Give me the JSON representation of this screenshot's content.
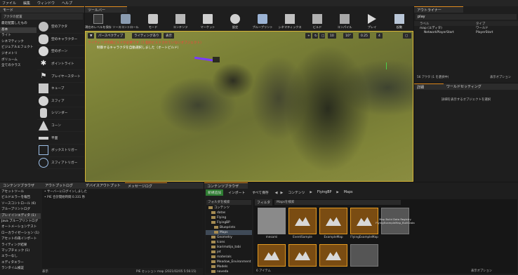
{
  "menu": [
    "ファイル",
    "編集",
    "ウィンドウ",
    "ヘルプ"
  ],
  "modes_panel": {
    "tab": "モード",
    "search_placeholder": "アクタの配置",
    "categories": [
      "最近配置したもの",
      "基本",
      "ライト",
      "シネマティック",
      "ビジュアルエフェクト",
      "ジオメトリ",
      "ボリューム",
      "全てのクラス"
    ],
    "items": [
      "空のアクタ",
      "空のキャラクター",
      "空のポーン",
      "ポイントライト",
      "プレイヤースタート",
      "キューブ",
      "スフィア",
      "シリンダー",
      "コーン",
      "平面",
      "ボックストリガー",
      "スフィアトリガー"
    ]
  },
  "toolbar": {
    "tab": "ツールバー",
    "buttons": [
      "現在のレベルを保存",
      "ソースコントロール",
      "モード",
      "コンテンツ",
      "マーケット",
      "設定",
      "ブループリント",
      "シネマティックス",
      "ビルド",
      "コンパイル",
      "プレイ",
      "起動"
    ]
  },
  "viewport": {
    "perspective": "パースペクティブ",
    "lighting": "ライティングあり",
    "show": "表示",
    "warning1": "ライティングの再ビルドが必要です（1 個のビルドされていないオブジェクト）",
    "warning2": "制御するキャラクタを自動選択しました（オートビルド）",
    "grid_values": [
      "10",
      "10°",
      "0.25",
      "4"
    ]
  },
  "outliner": {
    "tab": "アウトライナー",
    "search_value": "play",
    "col_label": "ラベル",
    "col_type": "タイプ",
    "rows": [
      {
        "label": "map (エディタ)",
        "type": "ワールド"
      },
      {
        "label": "NetworkPlayerStart",
        "type": "PlayerStart"
      }
    ],
    "footer": "56 アクタ (1 を選択中)",
    "view_options": "表示オプション"
  },
  "details": {
    "tab_details": "詳細",
    "tab_world": "ワールドセッティング",
    "empty_text": "詳細を表示するオブジェクトを選択"
  },
  "bottom_left": {
    "tabs": [
      "コンテンツブラウザ",
      "アウトプットログ",
      "デバイスアウトプット",
      "メッセージログ"
    ],
    "categories": [
      "アセットツール",
      "ビルドエラーを報告",
      "ソースコントロール (6)",
      "ブループリントログ",
      "プレイインエディタ (1)",
      "Java ブループリントログ",
      "オートメーションテスト",
      "ローカライゼーション (1)",
      "アセットの再インポート",
      "ライティング結果",
      "マップチェック (1)",
      "エラーなし",
      "エディタエラー",
      "ランタイム検証"
    ],
    "log_lines": [
      "サーバーにログインしました",
      "PIE 合計開始時間 0.331 秒"
    ],
    "footer_left": "表示",
    "footer_session": "PIE セッション map (2021/02/05 5:56:15)"
  },
  "content_browser": {
    "tab": "コンテンツブラウザ",
    "add_new": "新規追加",
    "import": "インポート",
    "save_all": "すべて保存",
    "path": [
      "コンテンツ",
      "FlyingBP",
      "Maps"
    ],
    "search_folders": "フォルダを検索",
    "search_assets": "Mapsを検索",
    "filter": "フィルタ",
    "folders": [
      "コンテンツ",
      "datas",
      "Flying",
      "FlyingBP",
      "Blueprints",
      "Maps",
      "Geometry",
      "Icons",
      "ikarimotijo_tobi",
      "jet",
      "materials",
      "Meadow_Environment",
      "Models",
      "naveda",
      "news"
    ],
    "assets": [
      "mesami",
      "EventSample",
      "ExampleMap",
      "FlyingExampleMap",
      "Map Build Data Registry FlyingExampleMap_BuiltData"
    ],
    "footer": "6 アイテム",
    "view_options": "表示オプション"
  },
  "colors": {
    "accent": "#e08a1e",
    "selection": "#3f4a57",
    "warning": "#ff3d3d"
  }
}
